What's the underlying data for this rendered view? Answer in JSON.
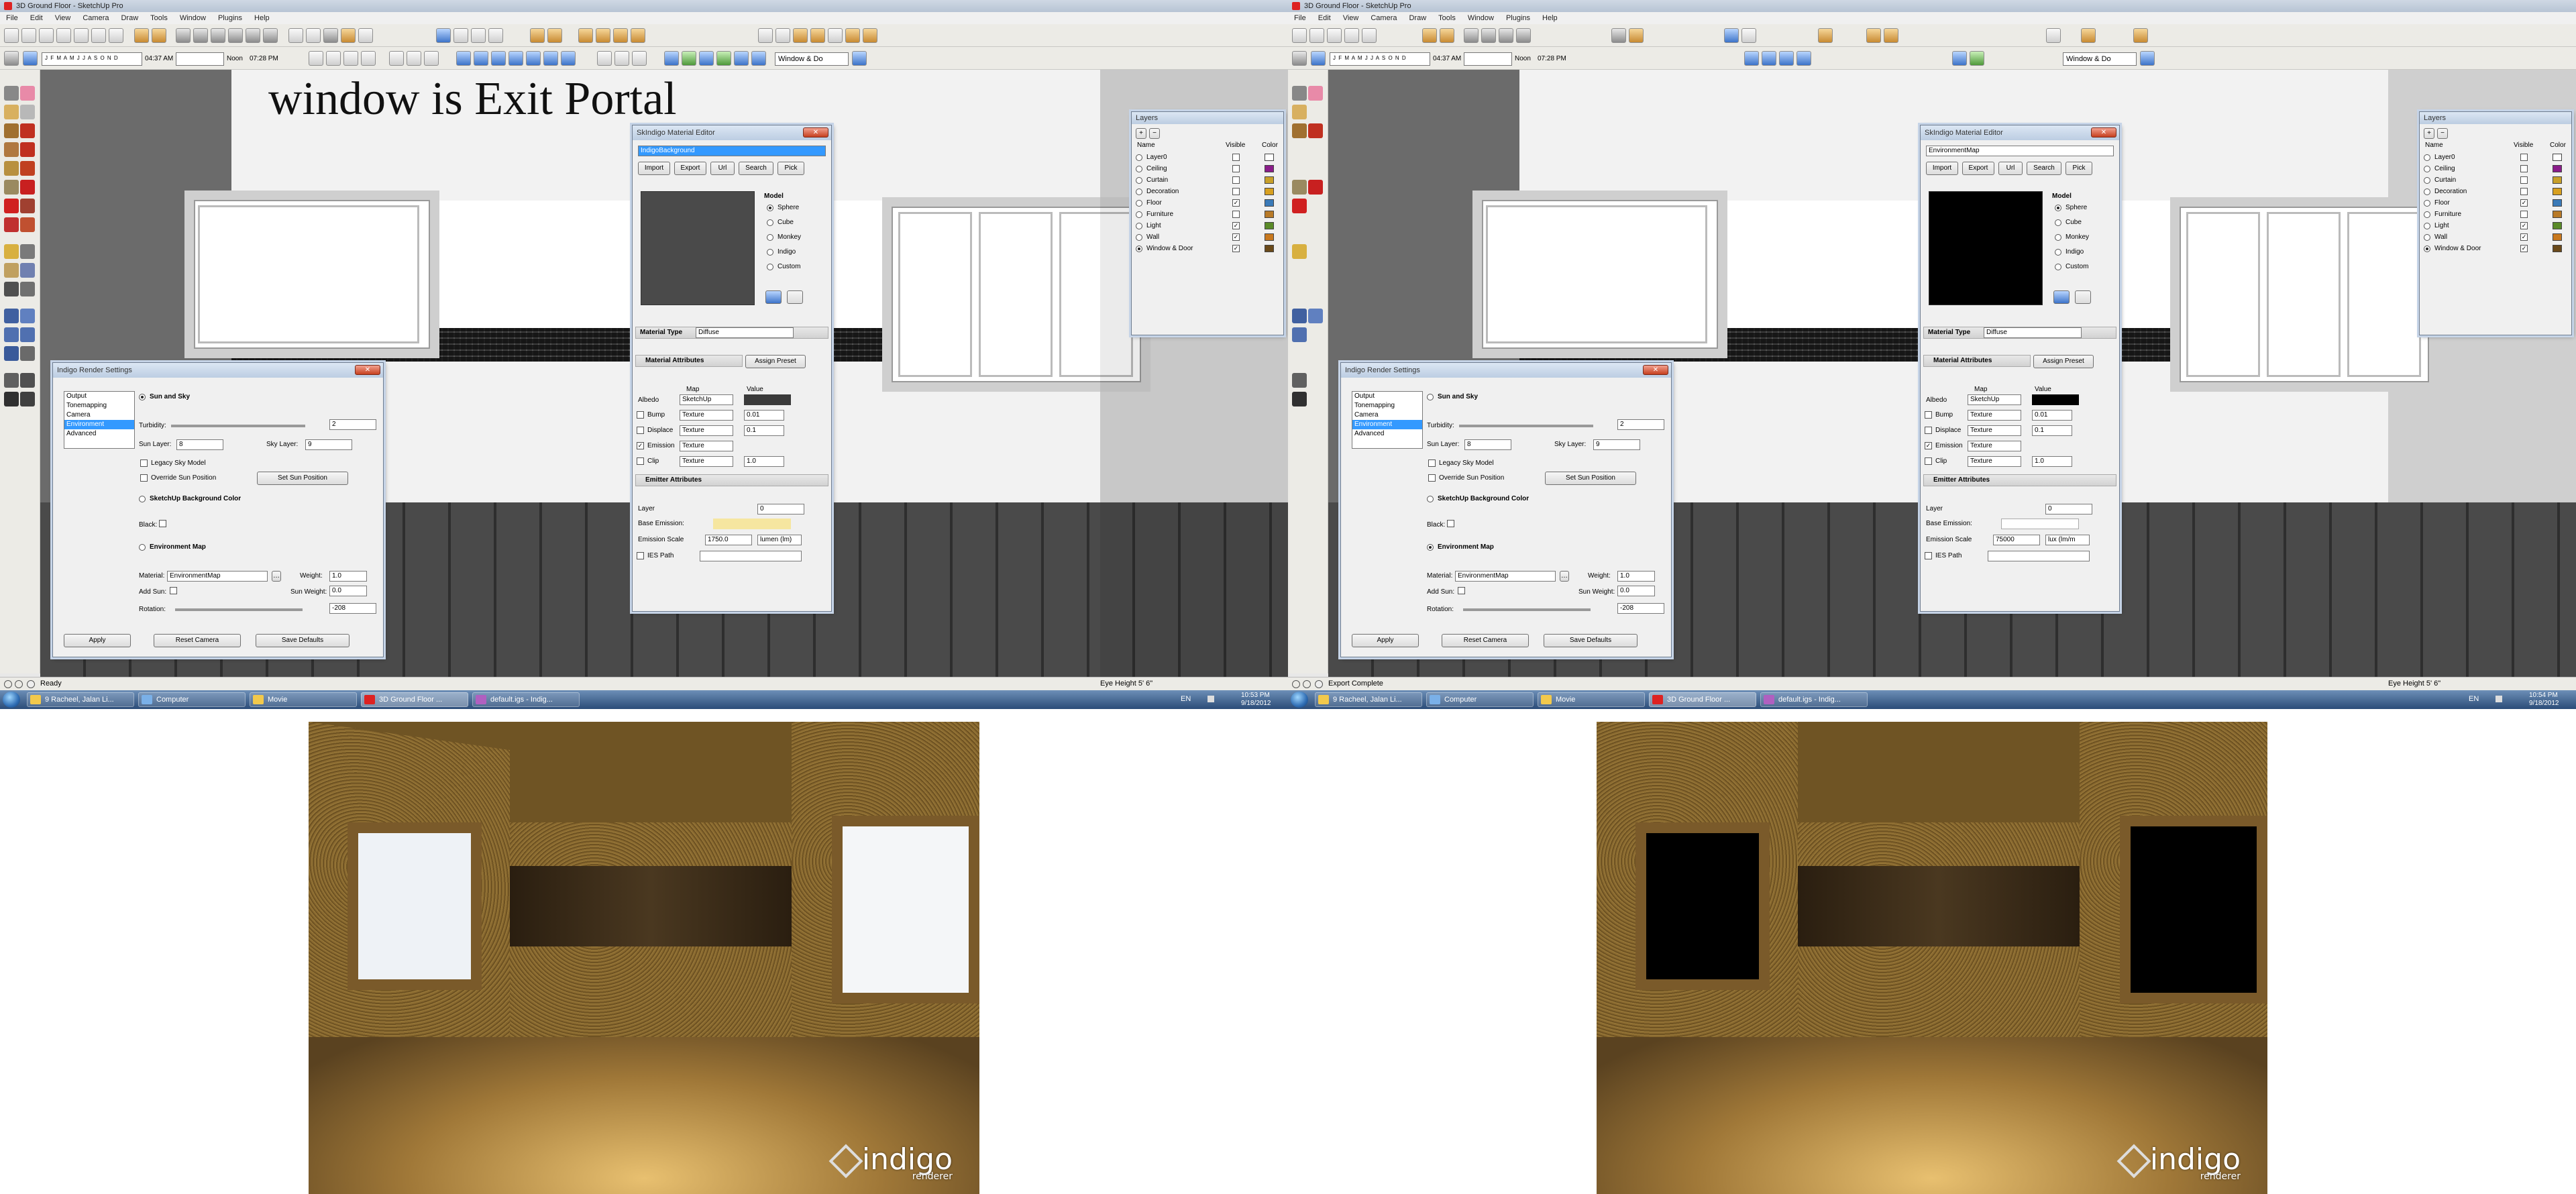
{
  "caption": "window is Exit Portal",
  "app": {
    "title": "3D Ground Floor - SketchUp Pro",
    "menus": [
      "File",
      "Edit",
      "View",
      "Camera",
      "Draw",
      "Tools",
      "Window",
      "Plugins",
      "Help"
    ],
    "shadow_months": "J F M A M J J A S O N D",
    "time_left": "04:37 AM",
    "noon": "Noon",
    "time_right": "07:28 PM",
    "layer_dropdown": "Window & Do"
  },
  "layers_panel": {
    "title": "Layers",
    "cols": [
      "Name",
      "Visible",
      "Color"
    ],
    "rows": [
      {
        "name": "Layer0",
        "visible": false,
        "color": "#ffffff"
      },
      {
        "name": "Ceiling",
        "visible": false,
        "color": "#8a1c8a"
      },
      {
        "name": "Curtain",
        "visible": false,
        "color": "#c8a02a"
      },
      {
        "name": "Decoration",
        "visible": false,
        "color": "#d8a020"
      },
      {
        "name": "Floor",
        "visible": true,
        "color": "#3a7ab8"
      },
      {
        "name": "Furniture",
        "visible": false,
        "color": "#b87a28"
      },
      {
        "name": "Light",
        "visible": true,
        "color": "#5a8a28"
      },
      {
        "name": "Wall",
        "visible": true,
        "color": "#c8781e"
      },
      {
        "name": "Window & Door",
        "visible": true,
        "color": "#6a4a1a"
      }
    ]
  },
  "left": {
    "material_editor": {
      "title": "SkIndigo Material Editor",
      "material": "IndigoBackground",
      "buttons": [
        "Import",
        "Export",
        "Url",
        "Search",
        "Pick"
      ],
      "model_label": "Model",
      "models": [
        "Sphere",
        "Cube",
        "Monkey",
        "Indigo",
        "Custom"
      ],
      "material_type_label": "Material Type",
      "material_type": "Diffuse",
      "material_attributes": "Material Attributes",
      "assign_preset": "Assign Preset",
      "map_header": "Map",
      "value_header": "Value",
      "attrs": [
        {
          "name": "Albedo",
          "map": "SketchUp",
          "value": ""
        },
        {
          "name": "Bump",
          "map": "Texture",
          "value": "0.01"
        },
        {
          "name": "Displace",
          "map": "Texture",
          "value": "0.1"
        },
        {
          "name": "Emission",
          "map": "Texture",
          "value": ""
        },
        {
          "name": "Clip",
          "map": "Texture",
          "value": "1.0"
        }
      ],
      "emitter_attributes": "Emitter Attributes",
      "layer_label": "Layer",
      "layer_value": "0",
      "base_emission_label": "Base Emission:",
      "emission_scale_label": "Emission Scale",
      "emission_scale_value": "1750.0",
      "emission_unit": "lumen (lm)",
      "ies_label": "IES Path"
    },
    "render_settings": {
      "title": "Indigo Render Settings",
      "nav": [
        "Output",
        "Tonemapping",
        "Camera",
        "Environment",
        "Advanced"
      ],
      "sun_sky": "Sun and Sky",
      "turbidity_label": "Turbidity:",
      "turbidity_value": "2",
      "sun_layer_label": "Sun Layer:",
      "sun_layer_value": "8",
      "sky_layer_label": "Sky Layer:",
      "sky_layer_value": "9",
      "legacy_sky": "Legacy Sky Model",
      "override_sun": "Override Sun Position",
      "set_sun": "Set Sun Position",
      "sketchup_bg": "SketchUp Background Color",
      "black_label": "Black:",
      "env_map": "Environment Map",
      "material_label": "Material:",
      "material_value": "EnvironmentMap",
      "weight_label": "Weight:",
      "weight_value": "1.0",
      "add_sun_label": "Add Sun:",
      "sun_weight_label": "Sun Weight:",
      "sun_weight_value": "0.0",
      "rotation_label": "Rotation:",
      "rotation_value": "-208",
      "apply": "Apply",
      "reset_camera": "Reset Camera",
      "save_defaults": "Save Defaults"
    },
    "status": "Ready",
    "eye_height": "Eye Height 5' 6\"",
    "clock_time": "10:53 PM",
    "clock_date": "9/18/2012"
  },
  "right": {
    "material_editor": {
      "material": "EnvironmentMap",
      "layer_value": "0",
      "emission_scale_value": "75000",
      "emission_unit": "lux (lm/m"
    },
    "status": "Export Complete",
    "eye_height": "Eye Height 5' 6\"",
    "clock_time": "10:54 PM",
    "clock_date": "9/18/2012"
  },
  "taskbar": {
    "lang": "EN",
    "items": [
      "9 Racheel, Jalan Li...",
      "Computer",
      "Movie",
      "3D Ground Floor ...",
      "default.igs - Indig..."
    ]
  },
  "renderer_logo": {
    "word": "indigo",
    "sub": "renderer"
  },
  "colors": {
    "selection": "#3399ff",
    "taskbar": "#2b4c78",
    "window_frame": "#c6d4e7"
  }
}
